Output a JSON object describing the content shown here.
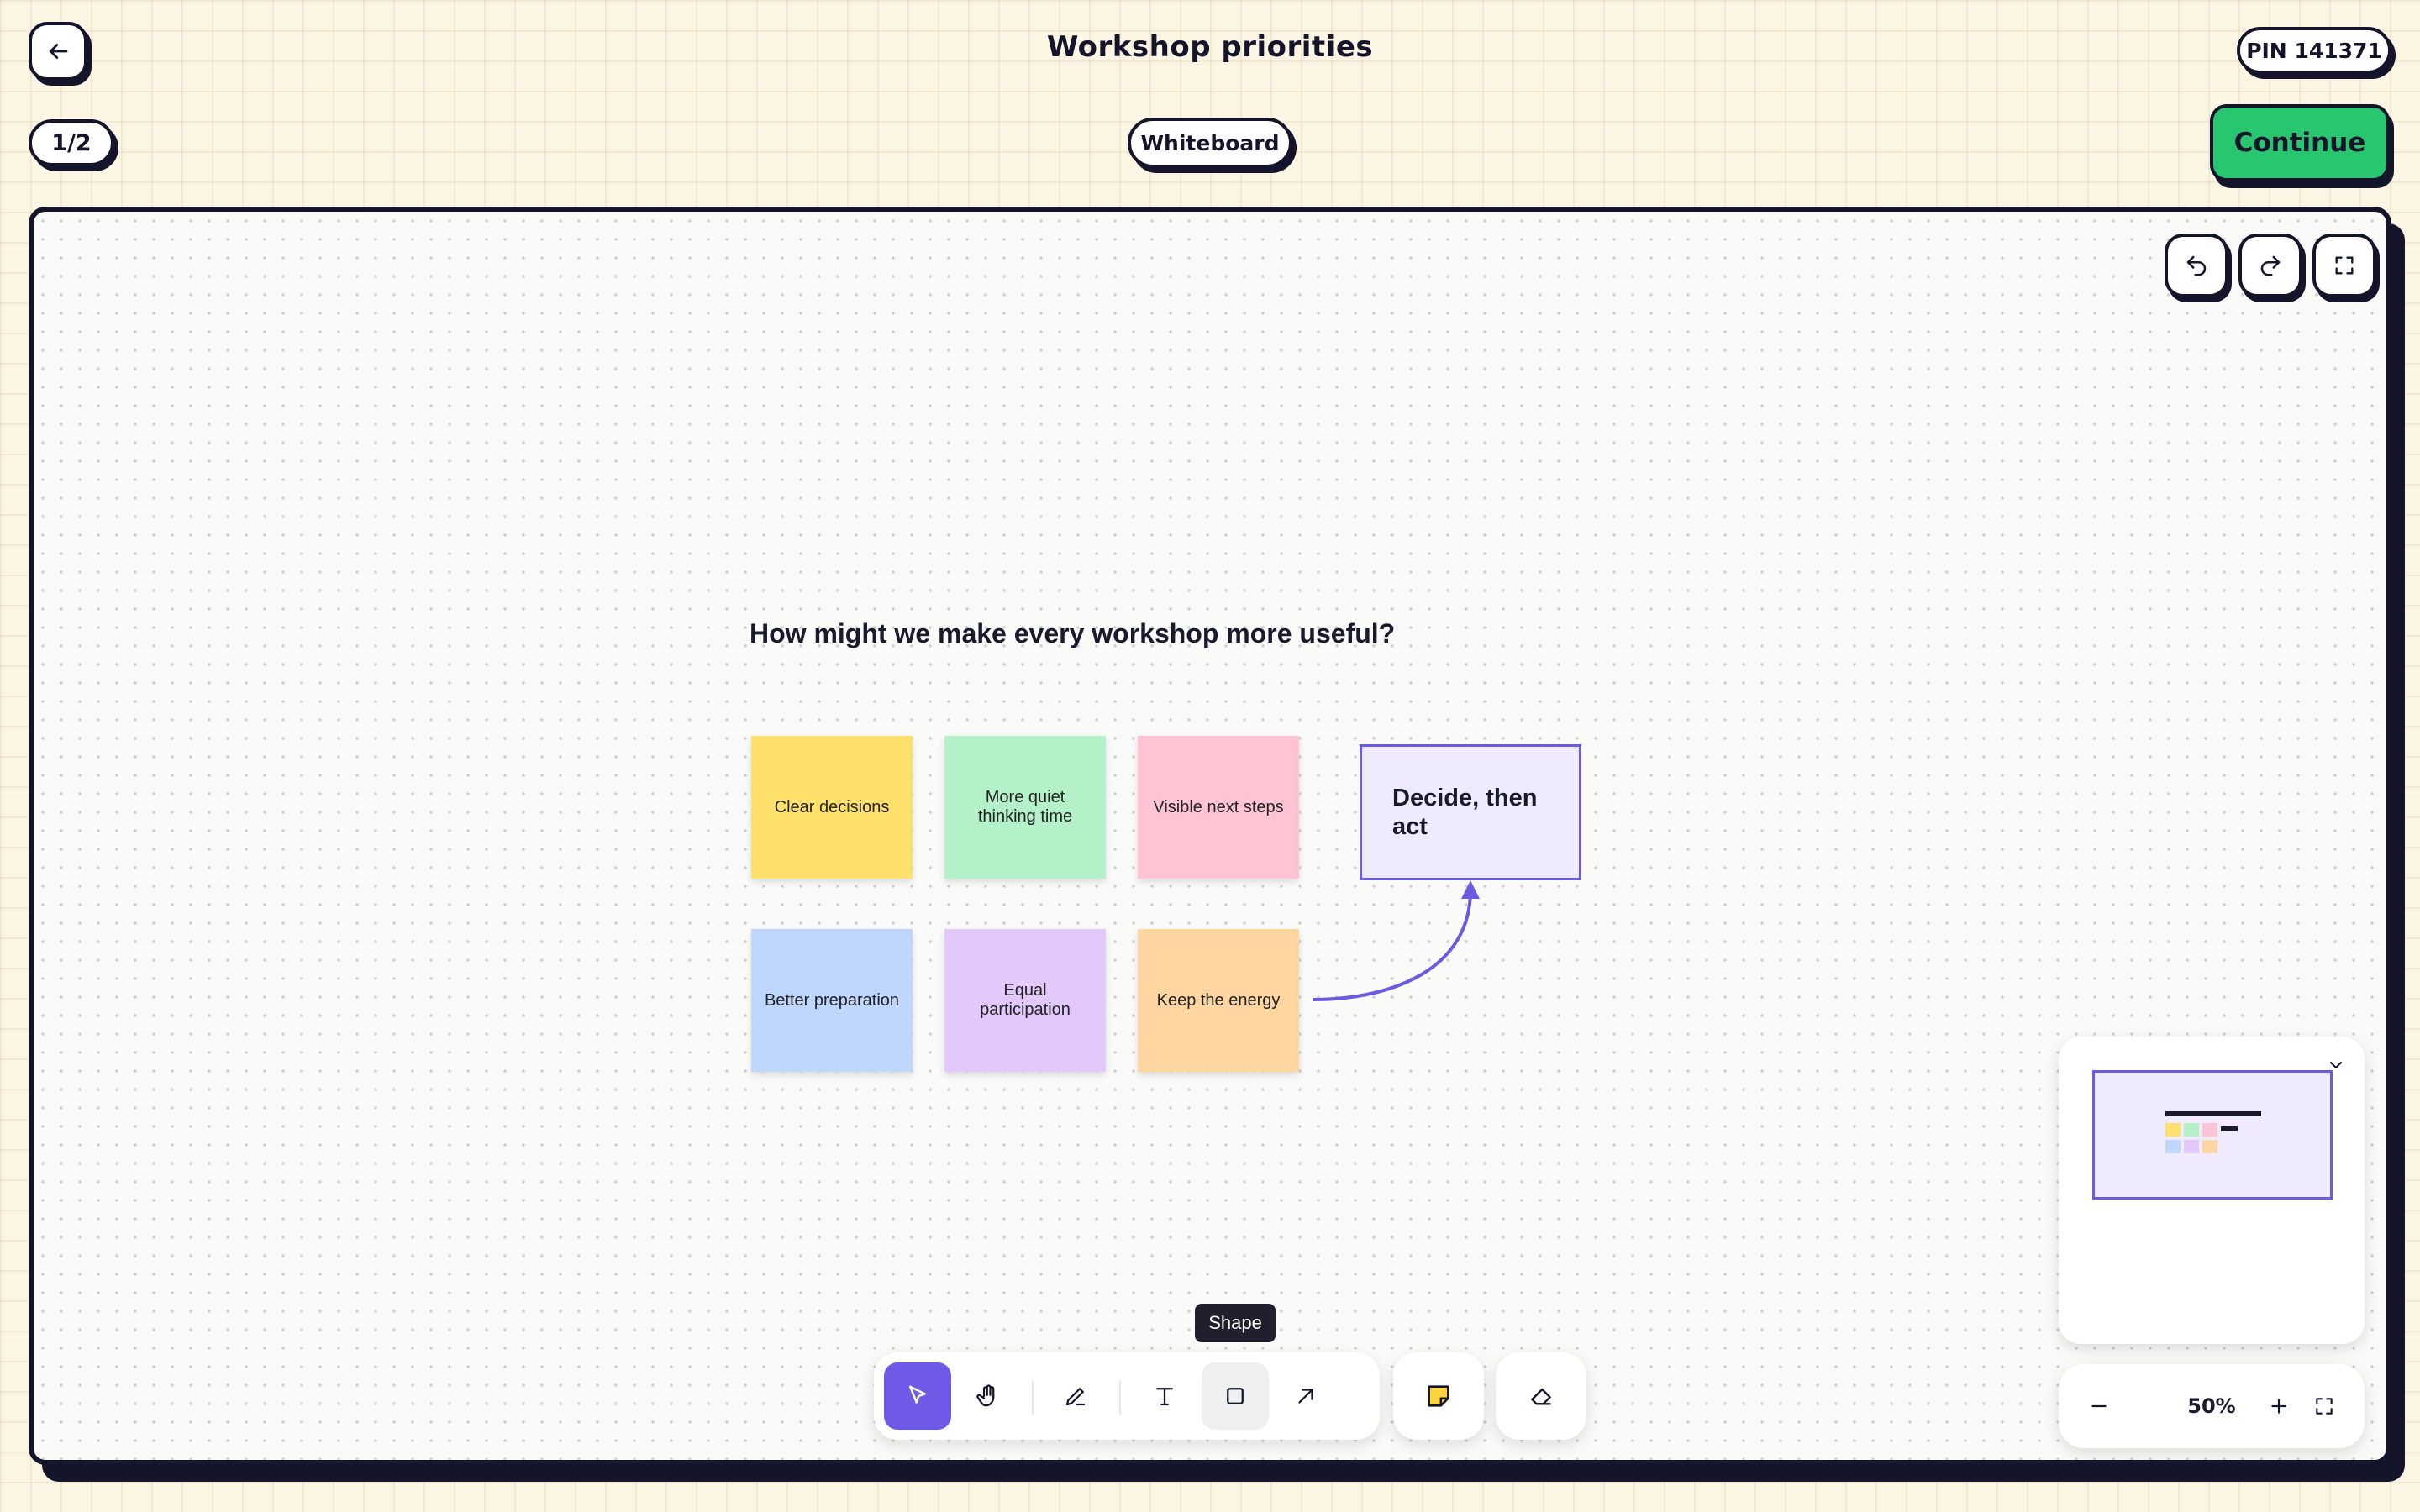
{
  "header": {
    "title": "Workshop priorities",
    "pin": "PIN 141371",
    "page_counter": "1/2",
    "mode": "Whiteboard",
    "continue_label": "Continue",
    "back_icon": "arrow-left-icon"
  },
  "canvas": {
    "prompt": "How might we make every workshop more useful?",
    "stickies": [
      {
        "text": "Clear decisions",
        "color": "#ffe06a"
      },
      {
        "text": "More quiet thinking time",
        "color": "#b4f0c8"
      },
      {
        "text": "Visible next steps",
        "color": "#ffc4d3"
      },
      {
        "text": "Better preparation",
        "color": "#bfd7ff"
      },
      {
        "text": "Equal participation",
        "color": "#e3c8fb"
      },
      {
        "text": "Keep the energy",
        "color": "#ffd6a2"
      }
    ],
    "decide_box": "Decide, then act",
    "controls": {
      "undo_icon": "undo-icon",
      "redo_icon": "redo-icon",
      "fullscreen_icon": "fullscreen-icon"
    }
  },
  "toolbar": {
    "tooltip": "Shape",
    "tools": [
      "select-icon",
      "hand-icon",
      "pen-icon",
      "text-icon",
      "shape-icon",
      "arrow-icon",
      "sticky-note-icon",
      "eraser-icon"
    ],
    "active_tool": "select",
    "accent_color": "#6e5ae6"
  },
  "minimap": {
    "collapse_icon": "chevron-down-icon"
  },
  "zoom": {
    "level": "50%"
  },
  "colors": {
    "brand_green": "#28c76f",
    "accent": "#6b5be0",
    "ink": "#14142b"
  }
}
